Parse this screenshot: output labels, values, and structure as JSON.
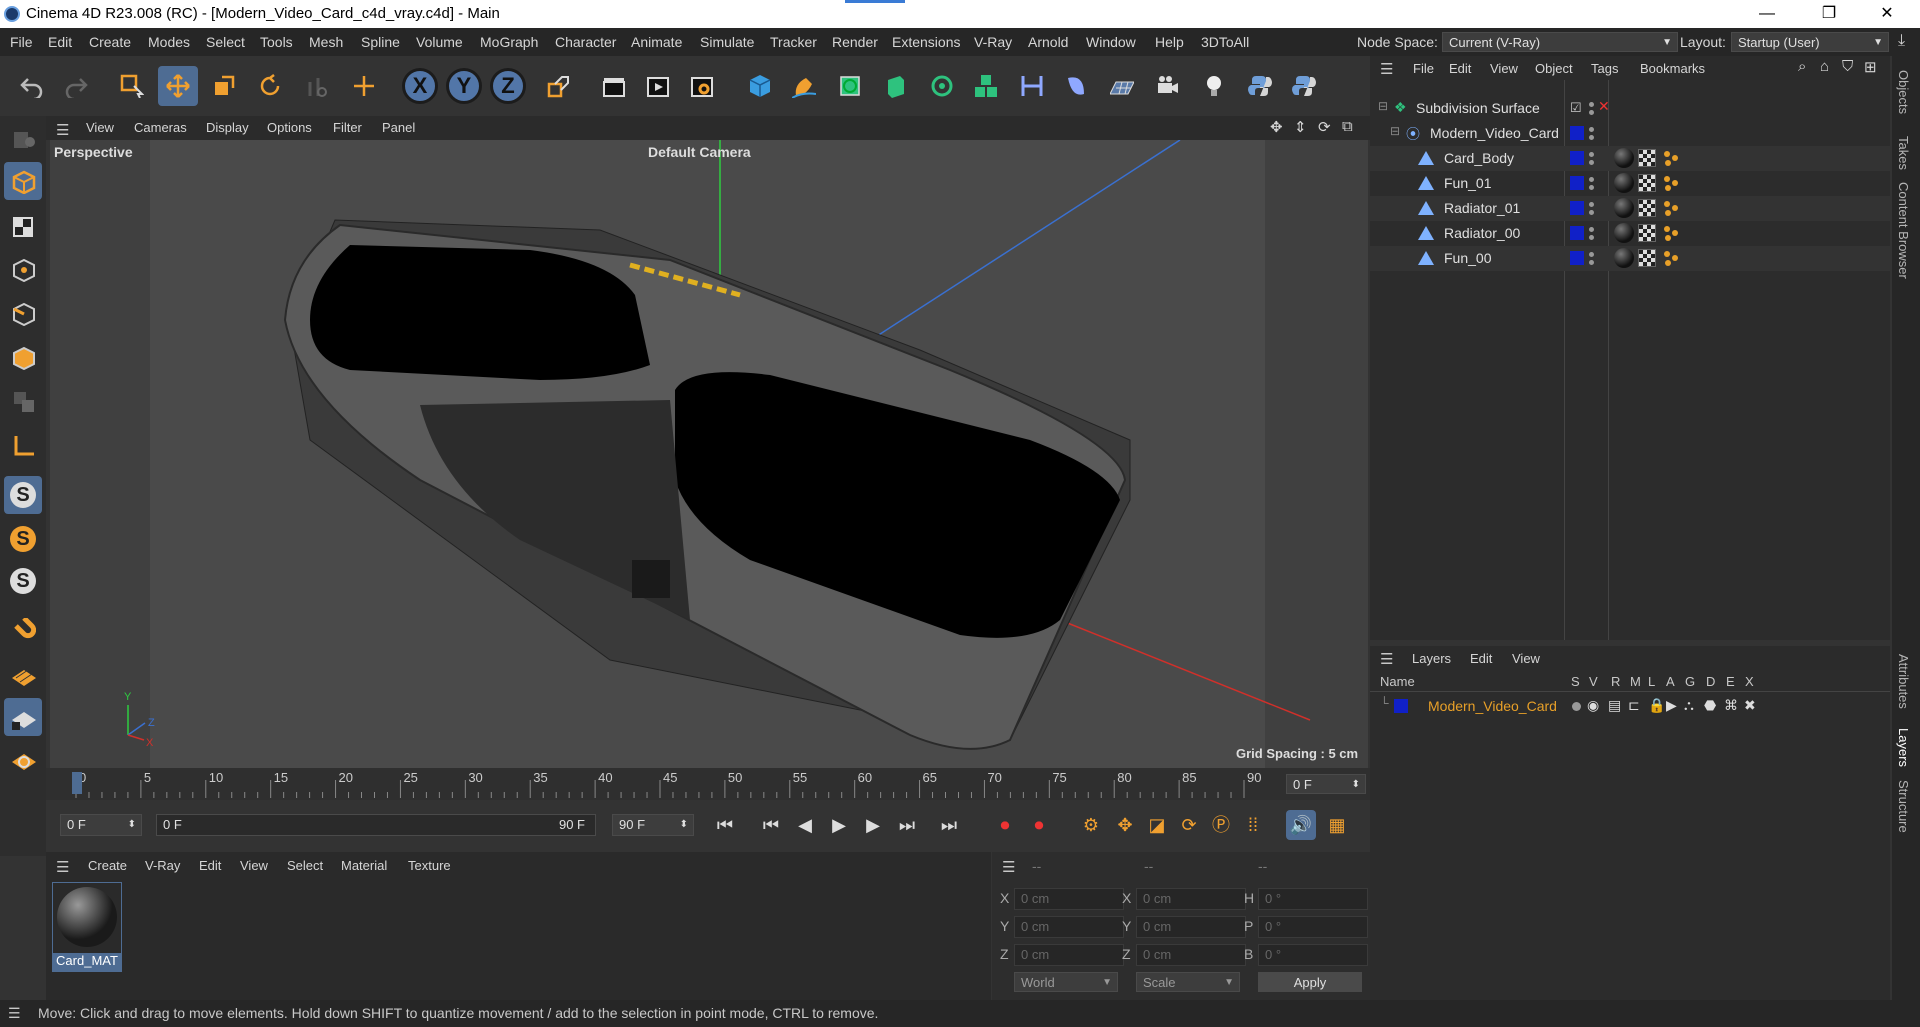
{
  "window": {
    "title": "Cinema 4D R23.008 (RC) - [Modern_Video_Card_c4d_vray.c4d] - Main",
    "controls": [
      "—",
      "❐",
      "✕"
    ]
  },
  "menu": {
    "items": [
      "File",
      "Edit",
      "Create",
      "Modes",
      "Select",
      "Tools",
      "Mesh",
      "Spline",
      "Volume",
      "MoGraph",
      "Character",
      "Animate",
      "Simulate",
      "Tracker",
      "Render",
      "Extensions",
      "V-Ray",
      "Arnold",
      "Window",
      "Help",
      "3DToAll"
    ],
    "node_space_label": "Node Space:",
    "node_space_value": "Current (V-Ray)",
    "layout_label": "Layout:",
    "layout_value": "Startup (User)"
  },
  "toolbar": {
    "axis_x": "X",
    "axis_y": "Y",
    "axis_z": "Z"
  },
  "left_tools": {
    "s1": "S",
    "s2": "S",
    "s3": "S"
  },
  "viewport": {
    "menu": [
      "View",
      "Cameras",
      "Display",
      "Options",
      "Filter",
      "Panel"
    ],
    "name": "Perspective",
    "camera": "Default Camera",
    "grid_spacing": "Grid Spacing : 5 cm",
    "axis_y": "Y",
    "axis_z": "Z",
    "axis_x": "X"
  },
  "timeline": {
    "ticks": [
      "0",
      "5",
      "10",
      "15",
      "20",
      "25",
      "30",
      "35",
      "40",
      "45",
      "50",
      "55",
      "60",
      "65",
      "70",
      "75",
      "80",
      "85",
      "90"
    ],
    "current_frame": "0 F",
    "start_frame": "0 F",
    "range_start": "0 F",
    "range_end": "90 F",
    "end_frame": "90 F"
  },
  "colors": {
    "accent_blue": "#4e6c93",
    "layer_orange": "#e8a028",
    "object_blue": "#1020c8"
  },
  "material_panel": {
    "menu": [
      "Create",
      "V-Ray",
      "Edit",
      "View",
      "Select",
      "Material",
      "Texture"
    ],
    "material_name": "Card_MAT"
  },
  "coord_panel": {
    "headers": [
      "--",
      "--",
      "--"
    ],
    "rows": [
      {
        "l1": "X",
        "v1": "0 cm",
        "l2": "X",
        "v2": "0 cm",
        "l3": "H",
        "v3": "0 °"
      },
      {
        "l1": "Y",
        "v1": "0 cm",
        "l2": "Y",
        "v2": "0 cm",
        "l3": "P",
        "v3": "0 °"
      },
      {
        "l1": "Z",
        "v1": "0 cm",
        "l2": "Z",
        "v2": "0 cm",
        "l3": "B",
        "v3": "0 °"
      }
    ],
    "space": "World",
    "mode": "Scale",
    "apply": "Apply"
  },
  "objects": {
    "menu": [
      "File",
      "Edit",
      "View",
      "Object",
      "Tags",
      "Bookmarks"
    ],
    "items": [
      {
        "name": "Subdivision Surface"
      },
      {
        "name": "Modern_Video_Card"
      },
      {
        "name": "Card_Body"
      },
      {
        "name": "Fun_01"
      },
      {
        "name": "Radiator_01"
      },
      {
        "name": "Radiator_00"
      },
      {
        "name": "Fun_00"
      }
    ]
  },
  "layers": {
    "menu": [
      "Layers",
      "Edit",
      "View"
    ],
    "header_name": "Name",
    "columns": [
      "S",
      "V",
      "R",
      "M",
      "L",
      "A",
      "G",
      "D",
      "E",
      "X"
    ],
    "items": [
      {
        "name": "Modern_Video_Card"
      }
    ]
  },
  "right_tabs": [
    "Objects",
    "Takes",
    "Content Browser",
    "Attributes",
    "Layers",
    "Structure"
  ],
  "status": "Move: Click and drag to move elements. Hold down SHIFT to quantize movement / add to the selection in point mode, CTRL to remove."
}
